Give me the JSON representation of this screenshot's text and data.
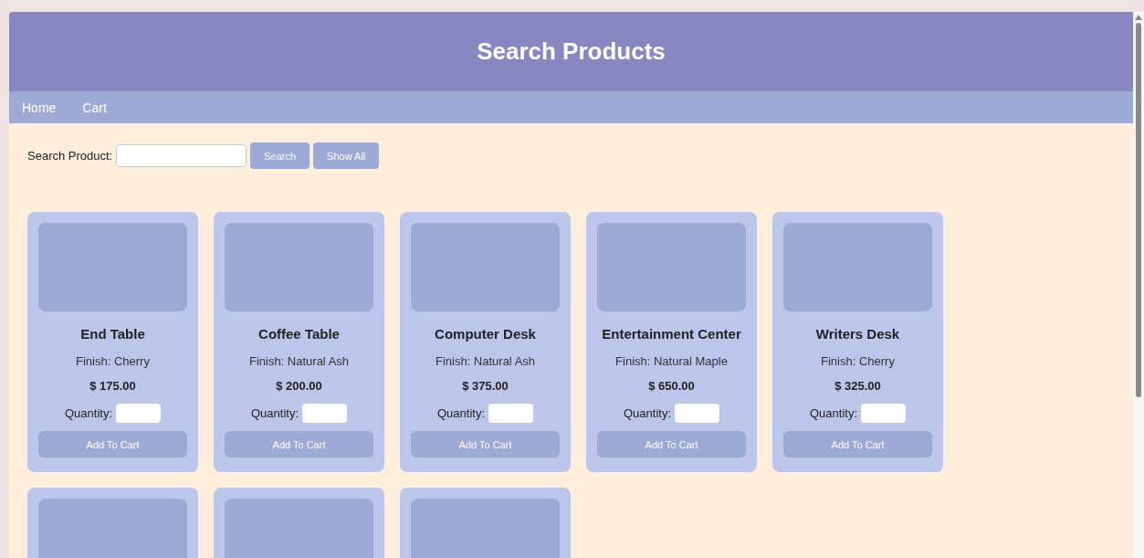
{
  "header": {
    "title": "Search Products"
  },
  "nav": [
    {
      "label": "Home"
    },
    {
      "label": "Cart"
    }
  ],
  "search": {
    "label": "Search Product:",
    "buttons": [
      "Search",
      "Show All"
    ]
  },
  "products": [
    {
      "kind": "card",
      "name": "End Table",
      "finish": "Finish: Cherry",
      "price": "$ 175.00",
      "quantity_label": "Quantity:",
      "button": "Add To Cart"
    },
    {
      "kind": "card",
      "name": "Coffee Table",
      "finish": "Finish: Natural Ash",
      "price": "$ 200.00",
      "quantity_label": "Quantity:",
      "button": "Add To Cart"
    },
    {
      "kind": "card",
      "name": "Computer Desk",
      "finish": "Finish: Natural Ash",
      "price": "$ 375.00",
      "quantity_label": "Quantity:",
      "button": "Add To Cart"
    },
    {
      "kind": "card",
      "name": "Entertainment Center",
      "finish": "Finish: Natural Maple",
      "price": "$ 650.00",
      "quantity_label": "Quantity:",
      "button": "Add To Cart"
    },
    {
      "kind": "card",
      "name": "Writers Desk",
      "finish": "Finish: Cherry",
      "price": "$ 325.00",
      "quantity_label": "Quantity:",
      "button": "Add To Cart"
    },
    {
      "kind": "cut"
    },
    {
      "kind": "cut"
    },
    {
      "kind": "cut"
    }
  ]
}
